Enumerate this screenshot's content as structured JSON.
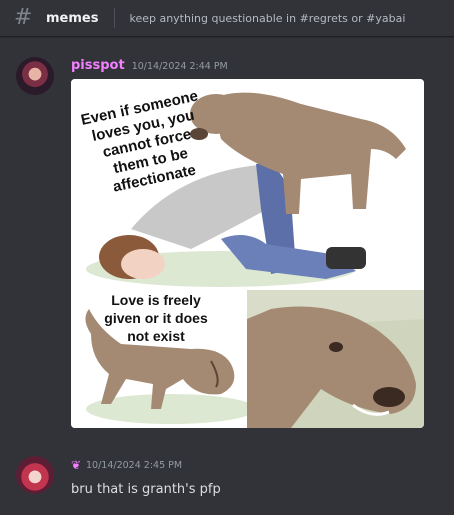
{
  "channel": {
    "name": "memes",
    "topic": "keep anything questionable in #regrets or #yabai",
    "icon": "hash-icon"
  },
  "messages": [
    {
      "author": "pisspot",
      "author_color": "#f47fff",
      "timestamp": "10/14/2024 2:44 PM",
      "meme": {
        "top_caption": [
          "Even if someone",
          "loves you, you",
          "cannot force",
          "them to be",
          "affectionate"
        ],
        "bottom_caption": [
          "Love is freely",
          "given or it does",
          "not exist"
        ]
      }
    },
    {
      "author_icon": "rose-icon",
      "timestamp": "10/14/2024 2:45 PM",
      "text": "bru that is granth's pfp"
    }
  ]
}
